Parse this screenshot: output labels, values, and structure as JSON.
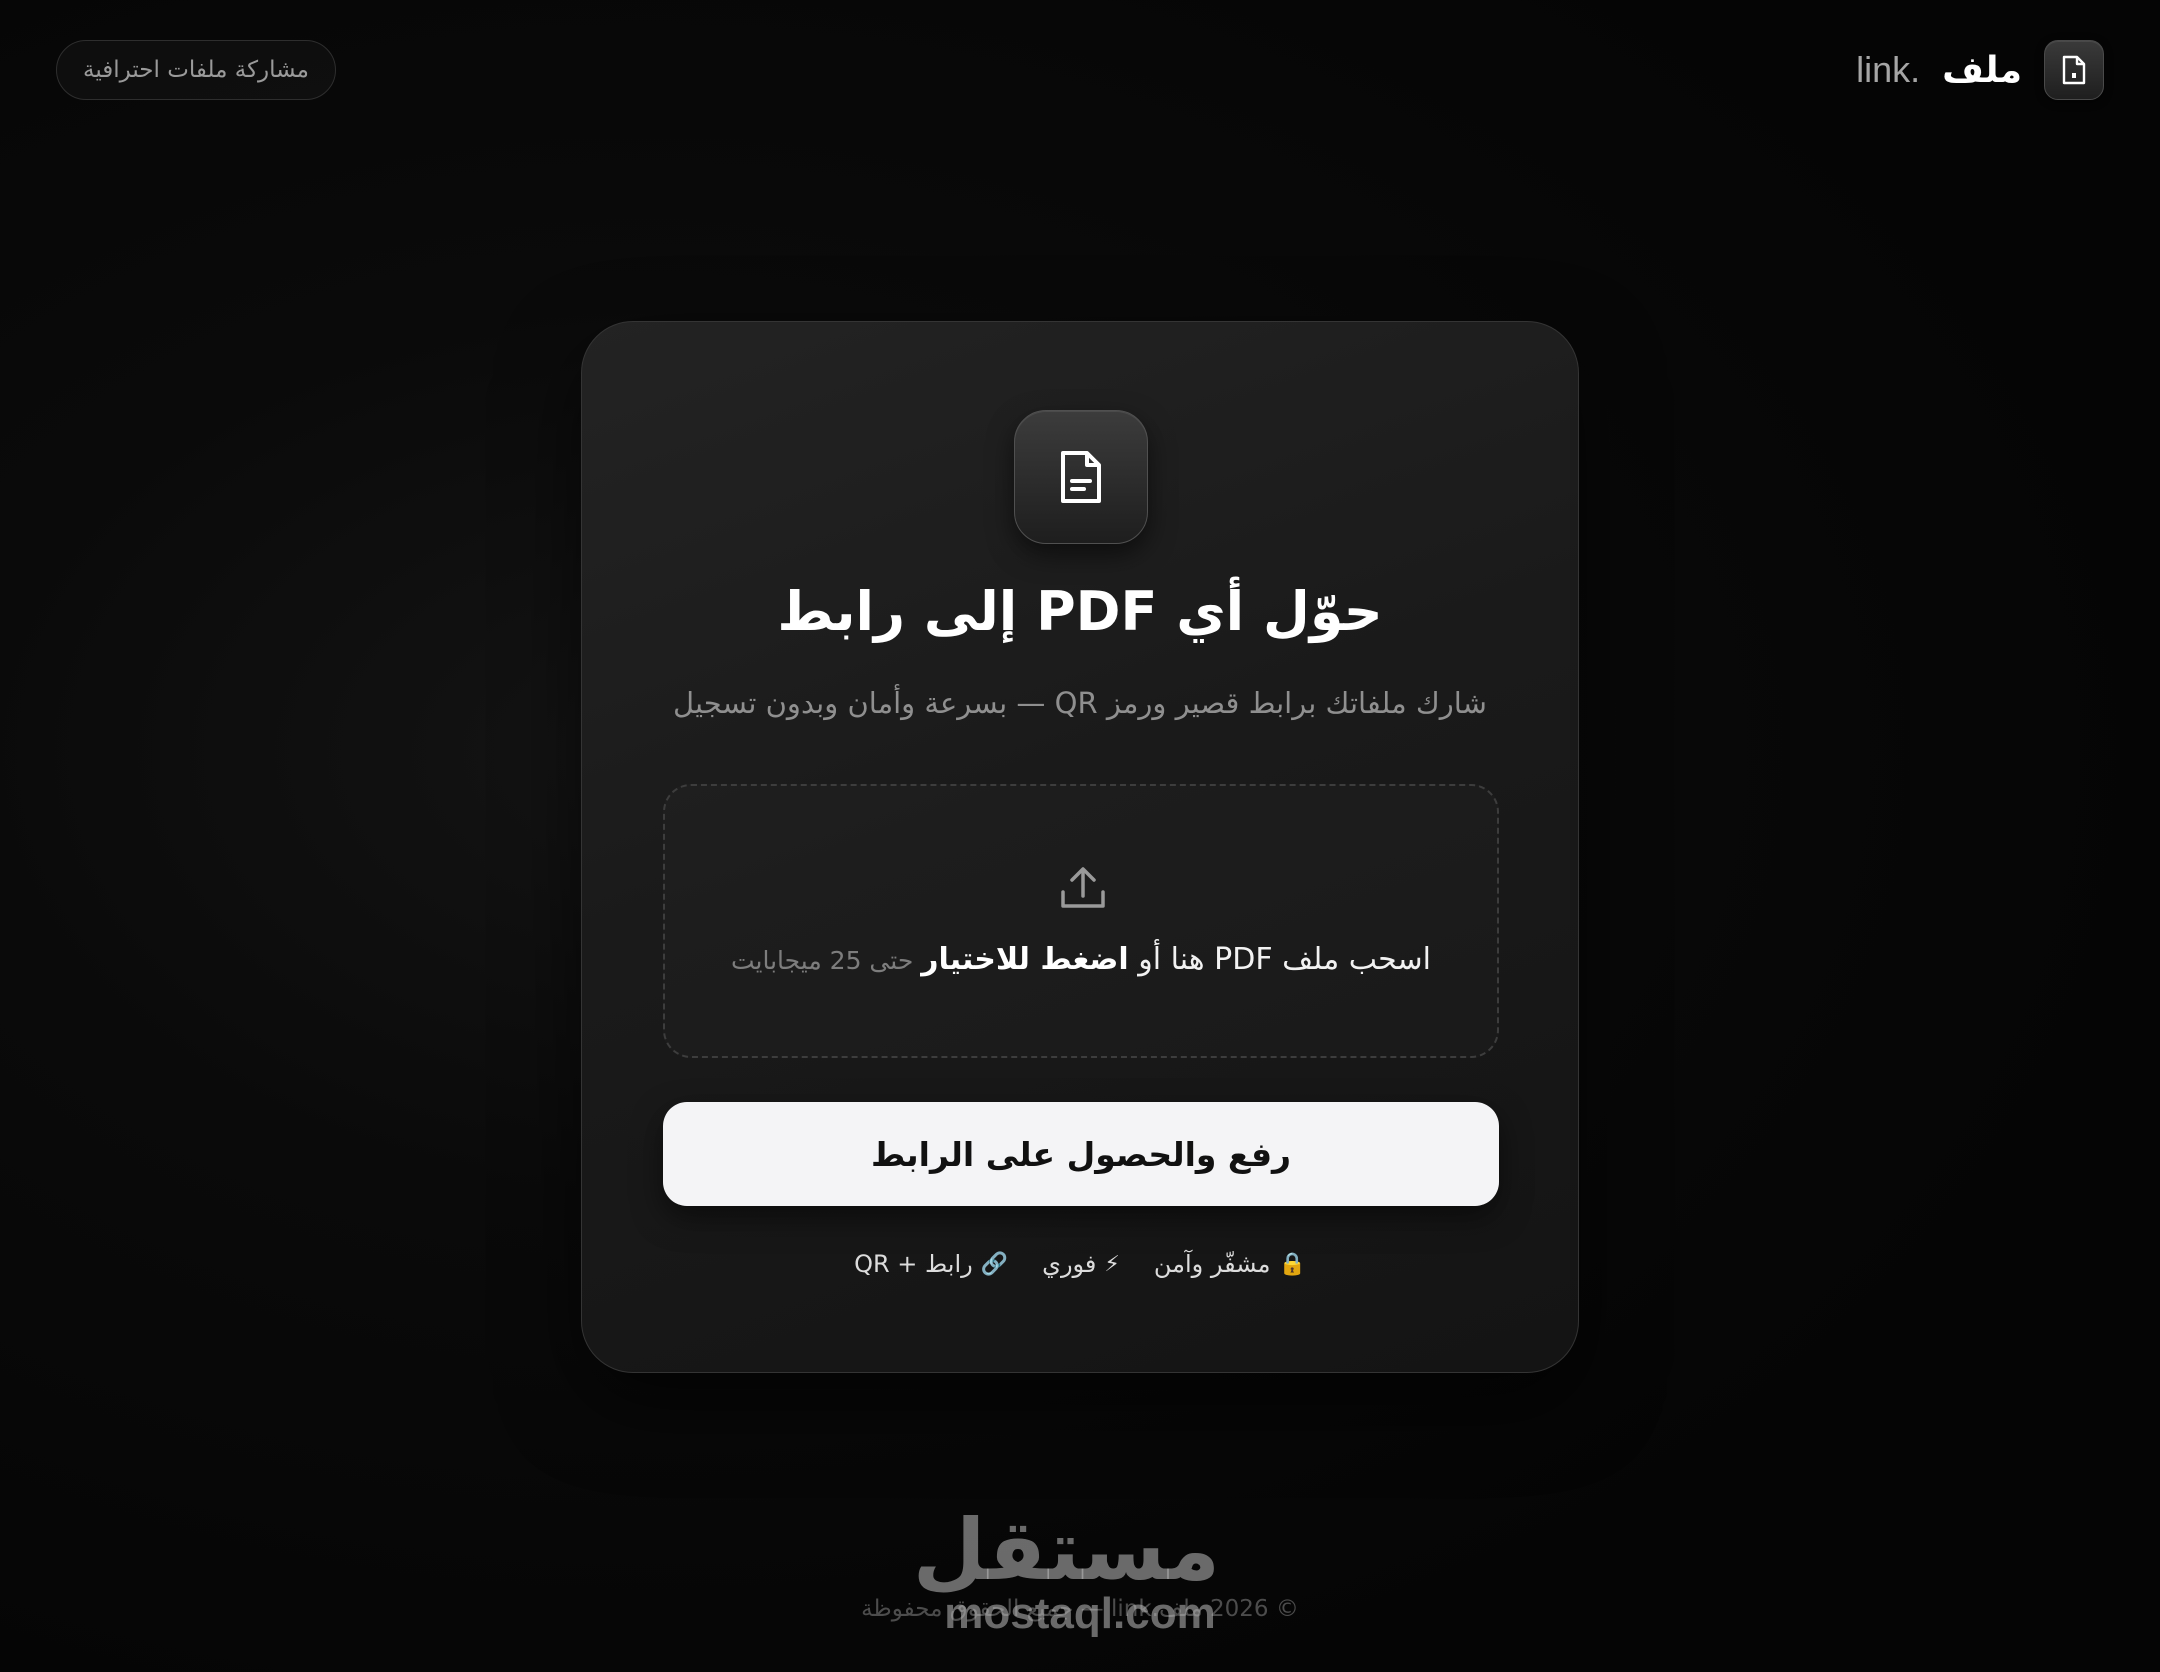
{
  "header": {
    "brand_name": "ملف",
    "brand_suffix": "link.",
    "pro_badge": "مشاركة ملفات احترافية",
    "brand_icon": "file-icon"
  },
  "card": {
    "hero_icon": "file-text-icon",
    "title": "حوّل أي PDF إلى رابط",
    "subtitle": "شارك ملفاتك برابط قصير ورمز QR — بسرعة وأمان وبدون تسجيل",
    "dropzone": {
      "icon": "upload-icon",
      "text_main": "اسحب ملف PDF هنا أو ",
      "text_strong": "اضغط للاختيار",
      "text_limit": " حتى 25 ميجابايت"
    },
    "primary_button": "رفع والحصول على الرابط",
    "features": [
      {
        "icon": "🔒",
        "label": "مشفّر وآمن"
      },
      {
        "icon": "⚡",
        "label": "فوري"
      },
      {
        "icon": "🔗",
        "label": "رابط + QR"
      }
    ]
  },
  "footer": {
    "copyright": "© 2026 ملف.link — جميع الحقوق محفوظة"
  },
  "watermark": {
    "arabic": "مستقل",
    "latin": "mostaql.com"
  },
  "colors": {
    "background": "#0a0a0a",
    "card": "#1c1c1c",
    "button": "#f4f4f6",
    "text_muted": "#8f8f8f"
  }
}
